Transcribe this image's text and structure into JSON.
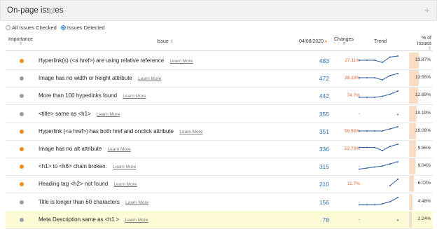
{
  "panel": {
    "title": "On-page issues"
  },
  "filters": {
    "all": "All Issues Checked",
    "detected": "Issues Detected",
    "selected": "detected"
  },
  "columns": {
    "importance": "Importance",
    "issue": "Issue",
    "date": "04/08/2020",
    "changes": "Changes",
    "trend": "Trend",
    "pct_line1": "% of",
    "pct_line2": "Issues"
  },
  "learn_more": "Learn More",
  "colors": {
    "orange": "#f28c1a",
    "gray": "#9aa0a6",
    "count": "#2f6fb4",
    "change": "#e8632a",
    "pctbar": "#f8dcc3"
  },
  "rows": [
    {
      "importance": "orange",
      "issue": "Hyperlink(s) (<a href>) are using relative reference",
      "count": "483",
      "change": "27.11%",
      "pct": "13.87%",
      "pct_value": 13.87,
      "trend": [
        6,
        6,
        6,
        4,
        9,
        10
      ]
    },
    {
      "importance": "gray",
      "issue": "Image has no width or height attribute",
      "count": "472",
      "change": "39.23%",
      "pct": "13.55%",
      "pct_value": 13.55,
      "trend": [
        6,
        6,
        6,
        4,
        8,
        10
      ]
    },
    {
      "importance": "gray",
      "issue": "More than 100 hyperlinks found",
      "count": "442",
      "change": "74.7%",
      "pct": "12.69%",
      "pct_value": 12.69,
      "trend": [
        4,
        4,
        4,
        5,
        7,
        10
      ]
    },
    {
      "importance": "gray",
      "issue": "<title> same as <h1>",
      "count": "355",
      "change": "-",
      "pct": "10.19%",
      "pct_value": 10.19,
      "trend": [
        null,
        null,
        null,
        null,
        null,
        5
      ]
    },
    {
      "importance": "orange",
      "issue": "Hyperlink (<a href>) has both href and onclick attribute",
      "count": "351",
      "change": "59.55%",
      "pct": "10.08%",
      "pct_value": 10.08,
      "trend": [
        6,
        6,
        6,
        6,
        8,
        10
      ]
    },
    {
      "importance": "orange",
      "issue": "Image has no alt attribute",
      "count": "336",
      "change": "52.73%",
      "pct": "9.65%",
      "pct_value": 9.65,
      "trend": [
        7,
        7,
        7,
        4,
        8,
        10
      ]
    },
    {
      "importance": "orange",
      "issue": "<h1> to <h6> chain broken.",
      "count": "315",
      "change": "-",
      "pct": "9.04%",
      "pct_value": 9.04,
      "trend": [
        3,
        4,
        5,
        6,
        8,
        10
      ]
    },
    {
      "importance": "orange",
      "issue": "Heading tag <h2> not found",
      "count": "210",
      "change": "11.7%",
      "pct": "6.03%",
      "pct_value": 6.03,
      "trend": [
        null,
        null,
        null,
        null,
        4,
        10
      ]
    },
    {
      "importance": "gray",
      "issue": "Title is longer than 60 characters",
      "count": "156",
      "change": "-",
      "pct": "4.48%",
      "pct_value": 4.48,
      "trend": [
        3,
        3,
        3,
        4,
        6,
        10
      ]
    },
    {
      "importance": "gray",
      "issue": "Meta Description same as <h1 >",
      "count": "78",
      "change": "-",
      "pct": "2.24%",
      "pct_value": 2.24,
      "trend": [
        null,
        null,
        null,
        null,
        null,
        5
      ],
      "highlight": true
    }
  ]
}
